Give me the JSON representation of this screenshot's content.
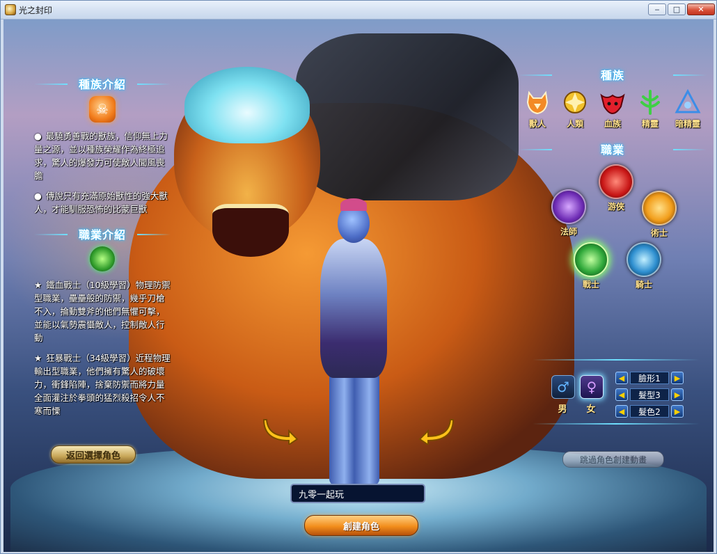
{
  "window": {
    "title": "光之封印",
    "min_symbol": "‒",
    "max_symbol": "□",
    "close_symbol": "✕"
  },
  "left_panel": {
    "race_intro_title": "種族介紹",
    "race_intro_paragraphs": [
      "最驍勇善戰的獸族，信仰無上力量之源，並以種族榮耀作為終極追求，驚人的爆發力可使敵人聞風喪膽",
      "傳說只有充滿原始獸性的強大獸人，才能馴服恐怖的比蒙巨獸"
    ],
    "race_intro_bullet": "●",
    "job_intro_title": "職業介紹",
    "job_intro_paragraphs": [
      "鐵血戰士（10級學習）物理防禦型職業，壘壘般的防禦，幾乎刀槍不入，掄動雙斧的他們無懼可擊，並能以氣勢震懾敵人，控制敵人行動",
      "狂暴戰士（34級學習）近程物理輸出型職業，他們擁有驚人的破壞力，衝鋒陷陣，捨棄防禦而將力量全面灌注於拳頭的猛烈殺招令人不寒而慄"
    ],
    "job_intro_bullet": "★"
  },
  "right_panel": {
    "race_title": "種族",
    "races": [
      {
        "label": "獸人",
        "icon": "beast-race-icon",
        "color": "#f38a25"
      },
      {
        "label": "人類",
        "icon": "human-race-icon",
        "color": "#f2c12c"
      },
      {
        "label": "血族",
        "icon": "blood-race-icon",
        "color": "#e2202c"
      },
      {
        "label": "精靈",
        "icon": "elf-race-icon",
        "color": "#3fcf45"
      },
      {
        "label": "暗精靈",
        "icon": "dark-elf-race-icon",
        "color": "#3b8de8"
      }
    ],
    "class_title": "職業",
    "classes": [
      {
        "label": "游俠",
        "icon": "ranger-class-icon",
        "color": "#e42c2c"
      },
      {
        "label": "法師",
        "icon": "mage-class-icon",
        "color": "#8a3fd0"
      },
      {
        "label": "術士",
        "icon": "warlock-class-icon",
        "color": "#f29e1b"
      },
      {
        "label": "戰士",
        "icon": "warrior-class-icon",
        "color": "#3ed04a"
      },
      {
        "label": "騎士",
        "icon": "knight-class-icon",
        "color": "#38a9e8"
      }
    ],
    "selected_class": "戰士"
  },
  "appearance": {
    "gender_male_symbol": "♂",
    "gender_female_symbol": "♀",
    "gender_male_label": "男",
    "gender_female_label": "女",
    "selected_gender": "女",
    "options": [
      {
        "value": "臉形1"
      },
      {
        "value": "髮型3"
      },
      {
        "value": "髮色2"
      }
    ],
    "prev_symbol": "◀",
    "next_symbol": "▶"
  },
  "buttons": {
    "back": "返回選擇角色",
    "skip": "跳過角色創建動畫",
    "create": "創建角色"
  },
  "name_input": {
    "value": "九零一起玩"
  },
  "colors": {
    "title_glow": "#37c6ff",
    "label_gold": "#ffe08c",
    "create_orange": "#f28e1c"
  }
}
